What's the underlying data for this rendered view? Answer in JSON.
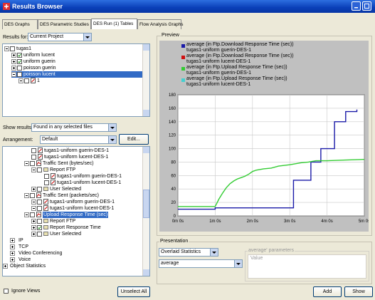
{
  "window": {
    "title": "Results Browser"
  },
  "tabs": [
    "DES Graphs",
    "DES Parametric Studies",
    "DES Run (1) Tables",
    "Flow Analysis Graphs"
  ],
  "results_for": {
    "label": "Results for:",
    "value": "Current Project"
  },
  "results_tree": [
    {
      "text": "tugas1"
    },
    {
      "text": "uniform lucent"
    },
    {
      "text": "uniform guerin"
    },
    {
      "text": "poisson guerin"
    },
    {
      "text": "poisson lucent"
    },
    {
      "text": "1"
    }
  ],
  "show_results": {
    "label": "Show results:",
    "value": "Found in any selected files"
  },
  "arrangement": {
    "label": "Arrangement:",
    "value": "Default",
    "edit_button": "Edit..."
  },
  "stats_tree": [
    {
      "text": "tugas1-uniform guerin-DES-1"
    },
    {
      "text": "tugas1-uniform lucent-DES-1"
    },
    {
      "text": "Traffic Sent (bytes/sec)"
    },
    {
      "text": "Report FTP"
    },
    {
      "text": "tugas1-uniform guerin-DES-1"
    },
    {
      "text": "tugas1-uniform lucent-DES-1"
    },
    {
      "text": "User Selected"
    },
    {
      "text": "Traffic Sent (packets/sec)"
    },
    {
      "text": "tugas1-uniform guerin-DES-1"
    },
    {
      "text": "tugas1-uniform lucent-DES-1"
    },
    {
      "text": "Upload Response Time (sec)"
    },
    {
      "text": "Report FTP"
    },
    {
      "text": "Report Response Time"
    },
    {
      "text": "User Selected"
    },
    {
      "text": "IP"
    },
    {
      "text": "TCP"
    },
    {
      "text": "Video Conferencing"
    },
    {
      "text": "Voice"
    },
    {
      "text": "Object Statistics"
    }
  ],
  "ignore_views": {
    "label": "Ignore Views"
  },
  "unselect_all_button": "Unselect All",
  "preview": {
    "title": "Preview"
  },
  "presentation": {
    "title": "Presentation",
    "mode": "Overlaid Statistics",
    "filter": "average",
    "params_title": "average' parameters",
    "params_value_header": "Value"
  },
  "add_button": "Add",
  "show_button": "Show",
  "chart_data": {
    "type": "line",
    "series": [
      {
        "name": "average (in Ftp.Download Response Time (sec))",
        "subtitle": "tugas1-uniform guerin-DES-1",
        "color": "#1a1aa8",
        "x": [
          0,
          60,
          66,
          116,
          122,
          132,
          142,
          150,
          162,
          180,
          186,
          210,
          214,
          222,
          230,
          240,
          252,
          270,
          288
        ],
        "y": [
          10,
          12,
          12,
          12,
          12,
          12,
          12,
          12,
          12,
          12,
          53,
          53,
          80,
          80,
          100,
          100,
          140,
          155,
          158
        ]
      },
      {
        "name": "average (in Ftp.Download Response Time (sec))",
        "subtitle": "tugas1-uniform lucent-DES-1",
        "color": "#d01010",
        "x": [
          0
        ],
        "y": [
          0
        ]
      },
      {
        "name": "average (in Ftp.Upload Response Time (sec))",
        "subtitle": "tugas1-uniform guerin-DES-1",
        "color": "#33cc33",
        "x": [
          0,
          60,
          66,
          72,
          78,
          84,
          90,
          96,
          102,
          108,
          114,
          120,
          126,
          138,
          150,
          162,
          180,
          198,
          210,
          222,
          240,
          270,
          300
        ],
        "y": [
          14,
          14,
          25,
          34,
          42,
          48,
          52,
          55,
          57,
          59,
          62,
          66,
          68,
          70,
          71,
          74,
          76,
          79,
          80,
          82,
          82,
          83,
          84
        ]
      },
      {
        "name": "average (in Ftp.Upload Response Time (sec))",
        "subtitle": "tugas1-uniform lucent-DES-1",
        "color": "#44d0d0",
        "x": [
          0
        ],
        "y": [
          0
        ]
      }
    ],
    "xlim": [
      0,
      300
    ],
    "ylim": [
      0,
      180
    ],
    "xticks": [
      "0m 0s",
      "1m 0s",
      "2m 0s",
      "3m 0s",
      "4m 0s",
      "5m 0s"
    ],
    "xtick_values": [
      0,
      60,
      120,
      180,
      240,
      300
    ],
    "yticks": [
      0,
      20,
      40,
      60,
      80,
      100,
      120,
      140,
      160,
      180
    ],
    "grid": true,
    "legend": "top"
  }
}
